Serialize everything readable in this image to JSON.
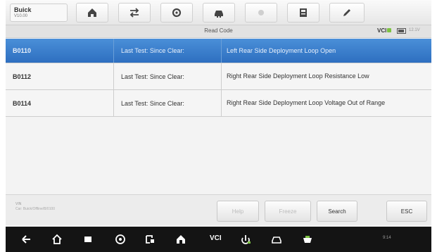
{
  "brand": {
    "name": "Buick",
    "version": "V10.00"
  },
  "toolbar": {
    "buttons": [
      {
        "icon": "home-icon"
      },
      {
        "icon": "vehicle-swap-icon"
      },
      {
        "icon": "settings-icon"
      },
      {
        "icon": "car-icon"
      },
      {
        "icon": "record-icon"
      },
      {
        "icon": "save-icon"
      },
      {
        "icon": "edit-icon"
      }
    ]
  },
  "header": {
    "title": "Read Code",
    "vci": "VCI",
    "battery_text": "12.1V"
  },
  "codes": [
    {
      "code": "B0110",
      "status": "Last Test: Since Clear:",
      "description": "Left Rear Side Deployment Loop Open",
      "selected": true
    },
    {
      "code": "B0112",
      "status": "Last Test: Since Clear:",
      "description": "Right Rear Side Deployment Loop Resistance Low",
      "selected": false
    },
    {
      "code": "B0114",
      "status": "Last Test: Since Clear:",
      "description": "Right Rear Side Deployment Loop Voltage Out of Range",
      "selected": false
    }
  ],
  "footer": {
    "vin_label": "VIN",
    "vin_path": "Car: Buick/Offline/B/0100",
    "buttons": {
      "help": "Help",
      "freeze": "Freeze",
      "search": "Search",
      "esc": "ESC"
    }
  },
  "navbar": {
    "vci_label": "VCI",
    "status_text": "9:14"
  },
  "colors": {
    "selected_row": "#2e6fc0",
    "navbar": "#141414",
    "vci_connected": "#7cc242"
  }
}
